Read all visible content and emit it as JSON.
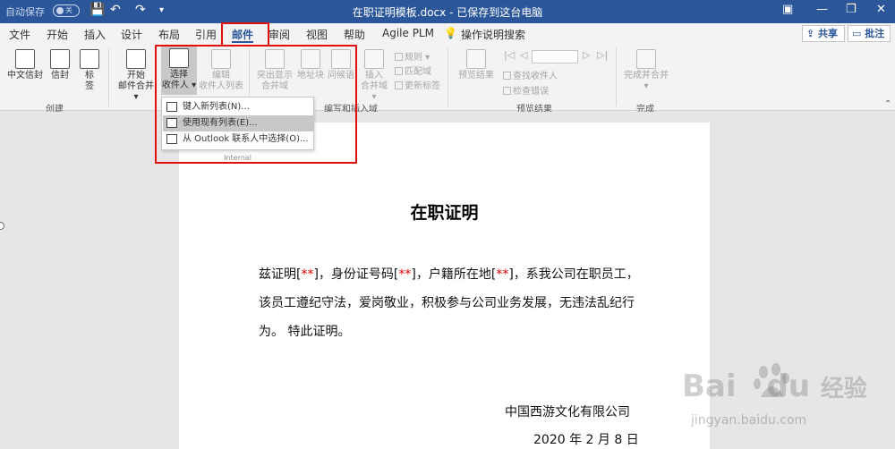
{
  "titlebar": {
    "autosave_label": "自动保存",
    "autosave_state": "关",
    "title": "在职证明模板.docx - 已保存到这台电脑"
  },
  "tabs": [
    {
      "label": "文件"
    },
    {
      "label": "开始"
    },
    {
      "label": "插入"
    },
    {
      "label": "设计"
    },
    {
      "label": "布局"
    },
    {
      "label": "引用"
    },
    {
      "label": "邮件"
    },
    {
      "label": "审阅"
    },
    {
      "label": "视图"
    },
    {
      "label": "帮助"
    },
    {
      "label": "Agile PLM"
    },
    {
      "label": "操作说明搜索"
    }
  ],
  "active_tab": "邮件",
  "share_label": "共享",
  "comment_label": "批注",
  "ribbon": {
    "create": {
      "label": "创建",
      "cn_envelope": "中文信封",
      "envelope": "信封",
      "labels_line1": "标",
      "labels_line2": "签"
    },
    "start_mail_merge": {
      "line1": "开始",
      "line2": "邮件合并"
    },
    "select_recipients": {
      "line1": "选择",
      "line2": "收件人"
    },
    "edit_recipients": {
      "line1": "编辑",
      "line2": "收件人列表"
    },
    "write_insert": {
      "label": "编写和插入域",
      "highlight_line1": "突出显示",
      "highlight_line2": "合并域",
      "address_block": "地址块",
      "greeting_line": "问候语",
      "insert_line1": "插入",
      "insert_line2": "合并域",
      "rules": "规则",
      "match_fields": "匹配域",
      "update_labels": "更新标签"
    },
    "preview": {
      "label": "预览结果",
      "preview_results": "预览结果",
      "find_recipient": "查找收件人",
      "check_errors": "检查错误"
    },
    "finish": {
      "label": "完成",
      "finish_merge": "完成并合并"
    }
  },
  "dropdown": {
    "items": [
      {
        "label": "键入新列表(N)..."
      },
      {
        "label": "使用现有列表(E)..."
      },
      {
        "label": "从 Outlook 联系人中选择(O)..."
      }
    ],
    "footer": "Internal"
  },
  "document": {
    "heading": "在职证明",
    "p1_a": "兹证明[",
    "p1_b": "**",
    "p1_c": "]，身份证号码[",
    "p1_d": "**",
    "p1_e": "]，户籍所在地[",
    "p1_f": "**",
    "p1_g": "]，系我公司在职员工，",
    "p2": "该员工遵纪守法，爱岗敬业，积极参与公司业务发展，无违法乱纪行",
    "p3": "为。 特此证明。",
    "company": "中国西游文化有限公司",
    "date": "2020 年 2 月 8 日"
  },
  "watermark": {
    "brand": "Bai",
    "brand2": "du",
    "cn": "经验",
    "url": "jingyan.baidu.com"
  },
  "colors": {
    "titlebar": "#2b579a",
    "highlight": "#e01010",
    "accent": "#2b579a"
  }
}
